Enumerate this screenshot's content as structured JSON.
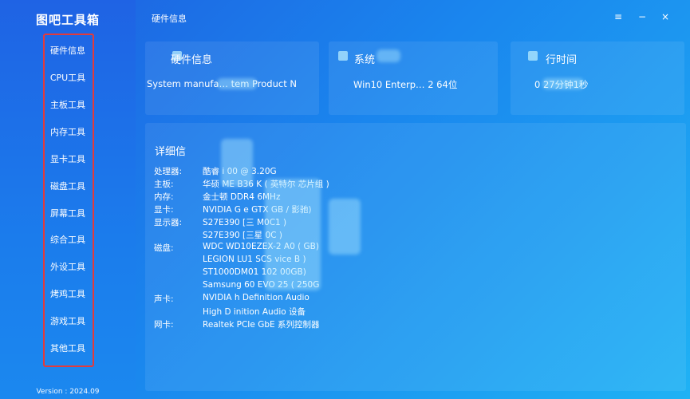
{
  "app": {
    "title": "图吧工具箱",
    "version": "Version : 2024.09"
  },
  "sidebar": {
    "items": [
      {
        "label": "硬件信息"
      },
      {
        "label": "CPU工具"
      },
      {
        "label": "主板工具"
      },
      {
        "label": "内存工具"
      },
      {
        "label": "显卡工具"
      },
      {
        "label": "磁盘工具"
      },
      {
        "label": "屏幕工具"
      },
      {
        "label": "综合工具"
      },
      {
        "label": "外设工具"
      },
      {
        "label": "烤鸡工具"
      },
      {
        "label": "游戏工具"
      },
      {
        "label": "其他工具"
      }
    ]
  },
  "header": {
    "title": "硬件信息",
    "menu_icon": "≡",
    "minimize_icon": "−",
    "close_icon": "×"
  },
  "cards": [
    {
      "title": "   硬件信息",
      "value": "System manufa…         tem Product N",
      "icon": "computer-icon"
    },
    {
      "title": "系统",
      "value": "Win10 Enterp…       2 64位",
      "icon": "windows-icon"
    },
    {
      "title": "行时间",
      "value": "0         27分钟1秒",
      "icon": "clock-icon"
    }
  ],
  "details": {
    "title": "详细信",
    "rows": [
      {
        "label": "处理器:",
        "value": "         酷睿 i        00 @ 3.20G"
      },
      {
        "label": "主板:",
        "value": "华硕       ME B36       K ( 英特尔          芯片组 )"
      },
      {
        "label": "内存:",
        "value": "金士顿         DDR4        6MHz"
      },
      {
        "label": "显卡:",
        "value": "NVIDIA G       e GTX             GB / 影驰)"
      },
      {
        "label": "显示器:",
        "value": "S27E390 [三         M0C1              )"
      },
      {
        "label": "",
        "value": "S27E390 [三星         0C            )"
      },
      {
        "label": "磁盘:",
        "value": "WDC WD10EZEX-2         A0 (            GB)"
      },
      {
        "label": "",
        "value": "LEGION LU1 SCS       vice          B )"
      },
      {
        "label": "",
        "value": "ST1000DM01        102       00GB)"
      },
      {
        "label": "",
        "value": "Samsung        60 EVO 25        ( 250G"
      },
      {
        "label": "声卡:",
        "value": "NVIDIA       h Definition Audio"
      },
      {
        "label": "",
        "value": "High D       inition Audio 设备"
      },
      {
        "label": "网卡:",
        "value": "Realtek PCIe GbE 系列控制器"
      }
    ]
  },
  "colors": {
    "accent": "#1a86ee",
    "nav_highlight_border": "#e33b3b"
  }
}
